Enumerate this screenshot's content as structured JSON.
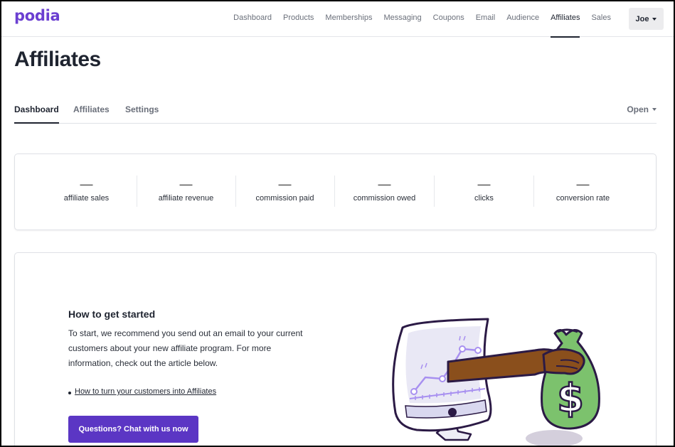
{
  "header": {
    "logo": "podia",
    "nav": [
      "Dashboard",
      "Products",
      "Memberships",
      "Messaging",
      "Coupons",
      "Email",
      "Audience",
      "Affiliates",
      "Sales"
    ],
    "active_nav": "Affiliates",
    "user": "Joe"
  },
  "page": {
    "title": "Affiliates",
    "tabs": [
      "Dashboard",
      "Affiliates",
      "Settings"
    ],
    "active_tab": "Dashboard",
    "filter": "Open"
  },
  "stats": [
    {
      "value": "—",
      "label": "affiliate sales"
    },
    {
      "value": "—",
      "label": "affiliate revenue"
    },
    {
      "value": "—",
      "label": "commission paid"
    },
    {
      "value": "—",
      "label": "commission owed"
    },
    {
      "value": "—",
      "label": "clicks"
    },
    {
      "value": "—",
      "label": "conversion rate"
    }
  ],
  "getting_started": {
    "title": "How to get started",
    "body": "To start, we recommend you send out an email to your current customers about your new affiliate program. For more information, check out the article below.",
    "link": "How to turn your customers into Affiliates",
    "button": "Questions? Chat with us now"
  },
  "colors": {
    "brand": "#6b3fd1",
    "button": "#5b36c4",
    "money_bag": "#7cc26d",
    "arm": "#8a4f1c"
  }
}
